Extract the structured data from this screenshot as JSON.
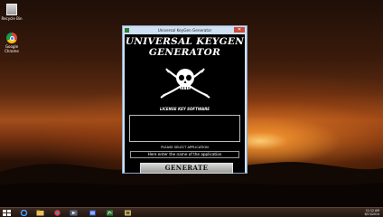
{
  "desktop": {
    "icons": [
      {
        "label": "Recycle Bin",
        "icon": "recycle-bin-icon"
      },
      {
        "label": "Google Chrome",
        "icon": "chrome-icon"
      }
    ]
  },
  "window": {
    "title": "Universal KeyGen Generator",
    "close_label": "✕",
    "heading_line1": "UNIVERSAL KEYGEN",
    "heading_line2": "GENERATOR",
    "subtitle": "LICENSE KEY SOFTWARE",
    "select_label": "PLEASE SELECT APPLICATION",
    "app_input_value": "Here enter the name of the application",
    "generate_label": "GENERATE"
  },
  "taskbar": {
    "items": [
      "start-icon",
      "ie-icon",
      "explorer-icon",
      "chrome-icon",
      "media-icon",
      "keygen-icon"
    ],
    "time": "11:12 AM",
    "date": "6/13/2014"
  }
}
